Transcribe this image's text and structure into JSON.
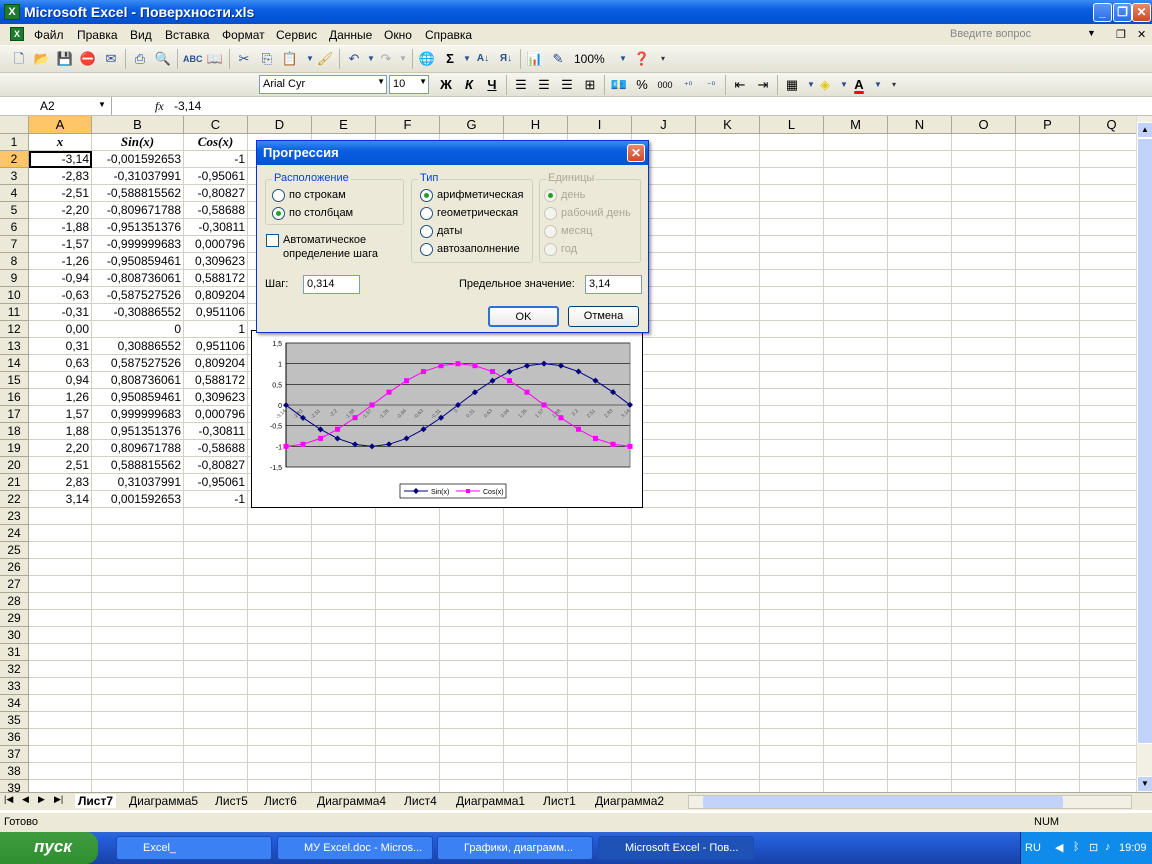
{
  "window": {
    "title": "Microsoft Excel - Поверхности.xls",
    "icon_text": "X"
  },
  "menu": {
    "items": [
      "Файл",
      "Правка",
      "Вид",
      "Вставка",
      "Формат",
      "Сервис",
      "Данные",
      "Окно",
      "Справка"
    ],
    "help_placeholder": "Введите вопрос"
  },
  "toolbar": {
    "zoom": "100%",
    "font": "Arial Cyr",
    "size": "10",
    "bold": "Ж",
    "italic": "К",
    "underline": "Ч",
    "percent": "%",
    "thousands": "000"
  },
  "formula_bar": {
    "name_box": "A2",
    "fx": "fx",
    "value": "-3,14"
  },
  "sheet": {
    "columns": [
      "A",
      "B",
      "C",
      "D",
      "E",
      "F",
      "G",
      "H",
      "I",
      "J",
      "K",
      "L",
      "M",
      "N",
      "O",
      "P",
      "Q"
    ],
    "rows": [
      "1",
      "2",
      "3",
      "4",
      "5",
      "6",
      "7",
      "8",
      "9",
      "10",
      "11",
      "12",
      "13",
      "14",
      "15",
      "16",
      "17",
      "18",
      "19",
      "20",
      "21",
      "22",
      "23",
      "24",
      "25",
      "26",
      "27",
      "28",
      "29",
      "30",
      "31",
      "32",
      "33",
      "34",
      "35",
      "36",
      "37",
      "38",
      "39"
    ],
    "header": [
      "x",
      "Sin(x)",
      "Cos(x)"
    ],
    "data": [
      [
        "-3,14",
        "-0,001592653",
        "-1"
      ],
      [
        "-2,83",
        "-0,31037991",
        "-0,95061"
      ],
      [
        "-2,51",
        "-0,588815562",
        "-0,80827"
      ],
      [
        "-2,20",
        "-0,809671788",
        "-0,58688"
      ],
      [
        "-1,88",
        "-0,951351376",
        "-0,30811"
      ],
      [
        "-1,57",
        "-0,999999683",
        "0,000796"
      ],
      [
        "-1,26",
        "-0,950859461",
        "0,309623"
      ],
      [
        "-0,94",
        "-0,808736061",
        "0,588172"
      ],
      [
        "-0,63",
        "-0,587527526",
        "0,809204"
      ],
      [
        "-0,31",
        "-0,30886552",
        "0,951106"
      ],
      [
        "0,00",
        "0",
        "1"
      ],
      [
        "0,31",
        "0,30886552",
        "0,951106"
      ],
      [
        "0,63",
        "0,587527526",
        "0,809204"
      ],
      [
        "0,94",
        "0,808736061",
        "0,588172"
      ],
      [
        "1,26",
        "0,950859461",
        "0,309623"
      ],
      [
        "1,57",
        "0,999999683",
        "0,000796"
      ],
      [
        "1,88",
        "0,951351376",
        "-0,30811"
      ],
      [
        "2,20",
        "0,809671788",
        "-0,58688"
      ],
      [
        "2,51",
        "0,588815562",
        "-0,80827"
      ],
      [
        "2,83",
        "0,31037991",
        "-0,95061"
      ],
      [
        "3,14",
        "0,001592653",
        "-1"
      ]
    ]
  },
  "dialog": {
    "title": "Прогрессия",
    "layout_label": "Расположение",
    "by_rows": "по строкам",
    "by_cols": "по столбцам",
    "type_label": "Тип",
    "types": [
      "арифметическая",
      "геометрическая",
      "даты",
      "автозаполнение"
    ],
    "units_label": "Единицы",
    "units": [
      "день",
      "рабочий день",
      "месяц",
      "год"
    ],
    "auto_step": "Автоматическое определение шага",
    "step_label": "Шаг:",
    "step_value": "0,314",
    "limit_label": "Предельное значение:",
    "limit_value": "3,14",
    "ok": "OK",
    "cancel": "Отмена"
  },
  "chart_data": {
    "type": "line",
    "x": [
      -3.14,
      -2.83,
      -2.51,
      -2.2,
      -1.88,
      -1.57,
      -1.26,
      -0.94,
      -0.63,
      -0.31,
      0,
      0.31,
      0.63,
      0.94,
      1.26,
      1.57,
      1.88,
      2.2,
      2.51,
      2.83,
      3.14
    ],
    "series": [
      {
        "name": "Sin(x)",
        "color": "#000080",
        "values": [
          -0.0016,
          -0.3104,
          -0.5888,
          -0.8097,
          -0.9514,
          -1.0,
          -0.9509,
          -0.8087,
          -0.5875,
          -0.3089,
          0,
          0.3089,
          0.5875,
          0.8087,
          0.9509,
          1.0,
          0.9514,
          0.8097,
          0.5888,
          0.3104,
          0.0016
        ]
      },
      {
        "name": "Cos(x)",
        "color": "#ff00ff",
        "values": [
          -1,
          -0.9506,
          -0.8083,
          -0.5869,
          -0.3081,
          0.0008,
          0.3096,
          0.5882,
          0.8092,
          0.9511,
          1,
          0.9511,
          0.8092,
          0.5882,
          0.3096,
          0.0008,
          -0.3081,
          -0.5869,
          -0.8083,
          -0.9506,
          -1
        ]
      }
    ],
    "yticks": [
      "1,5",
      "1",
      "0,5",
      "0",
      "-0,5",
      "-1",
      "-1,5"
    ],
    "ylim": [
      -1.5,
      1.5
    ],
    "grid": true,
    "legend": "bottom"
  },
  "tabs": {
    "items": [
      "Лист7",
      "Диаграмма5",
      "Лист5",
      "Лист6",
      "Диаграмма4",
      "Лист4",
      "Диаграмма1",
      "Лист1",
      "Диаграмма2"
    ]
  },
  "status": {
    "ready": "Готово",
    "num": "NUM"
  },
  "taskbar": {
    "start": "пуск",
    "tasks": [
      "Excel_",
      "МУ Excel.doc - Micros...",
      "Графики, диаграмм...",
      "Microsoft Excel - Пов..."
    ],
    "lang": "RU",
    "clock": "19:09"
  }
}
